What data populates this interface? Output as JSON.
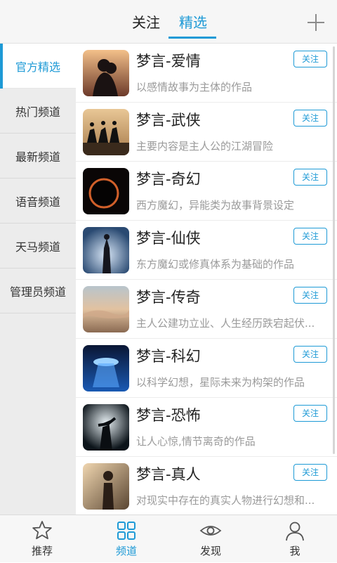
{
  "header": {
    "tabs": [
      {
        "label": "关注"
      },
      {
        "label": "精选"
      }
    ],
    "add_icon": "plus-icon"
  },
  "sidebar": {
    "items": [
      {
        "label": "官方精选",
        "active": true
      },
      {
        "label": "热门频道"
      },
      {
        "label": "最新频道"
      },
      {
        "label": "语音频道"
      },
      {
        "label": "天马频道"
      },
      {
        "label": "管理员频道"
      }
    ]
  },
  "channels": [
    {
      "title": "梦言-爱情",
      "desc": "以感情故事为主体的作品",
      "follow": "关注"
    },
    {
      "title": "梦言-武侠",
      "desc": "主要内容是主人公的江湖冒险",
      "follow": "关注"
    },
    {
      "title": "梦言-奇幻",
      "desc": "西方魔幻，异能类为故事背景设定",
      "follow": "关注"
    },
    {
      "title": "梦言-仙侠",
      "desc": "东方魔幻或修真体系为基础的作品",
      "follow": "关注"
    },
    {
      "title": "梦言-传奇",
      "desc": "主人公建功立业、人生经历跌宕起伏...",
      "follow": "关注"
    },
    {
      "title": "梦言-科幻",
      "desc": "以科学幻想，星际未来为构架的作品",
      "follow": "关注"
    },
    {
      "title": "梦言-恐怖",
      "desc": "让人心惊,情节离奇的作品",
      "follow": "关注"
    },
    {
      "title": "梦言-真人",
      "desc": "对现实中存在的真实人物进行幻想和...",
      "follow": "关注"
    }
  ],
  "bottom_nav": {
    "items": [
      {
        "label": "推荐",
        "icon": "star-icon"
      },
      {
        "label": "频道",
        "icon": "grid-icon",
        "active": true
      },
      {
        "label": "发现",
        "icon": "eye-icon"
      },
      {
        "label": "我",
        "icon": "person-icon"
      }
    ]
  },
  "colors": {
    "accent": "#1e9ad6",
    "sidebar_bg": "#ececec",
    "desc_text": "#9a9a9a"
  }
}
